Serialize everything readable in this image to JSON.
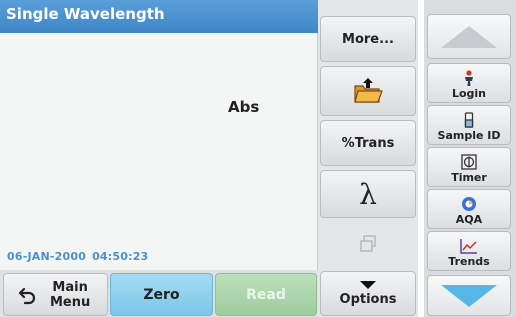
{
  "title": "Single Wavelength",
  "measurement": {
    "label": "Abs"
  },
  "status": {
    "date": "06-JAN-2000",
    "time": "04:50:23"
  },
  "middle": {
    "more_label": "More...",
    "trans_label": "%Trans",
    "lambda_symbol": "λ",
    "options_label": "Options"
  },
  "bottom": {
    "main_menu_label_line1": "Main",
    "main_menu_label_line2": "Menu",
    "zero_label": "Zero",
    "read_label": "Read"
  },
  "tools": [
    {
      "label": "Login",
      "icon": "person-icon"
    },
    {
      "label": "Sample ID",
      "icon": "sample-vial-icon"
    },
    {
      "label": "Timer",
      "icon": "timer-icon"
    },
    {
      "label": "AQA",
      "icon": "aqa-icon"
    },
    {
      "label": "Trends",
      "icon": "trends-chart-icon"
    }
  ],
  "colors": {
    "title_bar": "#4a90d0",
    "zero_button": "#8fd0ec",
    "read_button_disabled": "#a9d4a9",
    "datetime_text": "#4a90d0",
    "scroll_up_arrow": "#c7cbcf",
    "scroll_down_arrow": "#56b7e6"
  }
}
